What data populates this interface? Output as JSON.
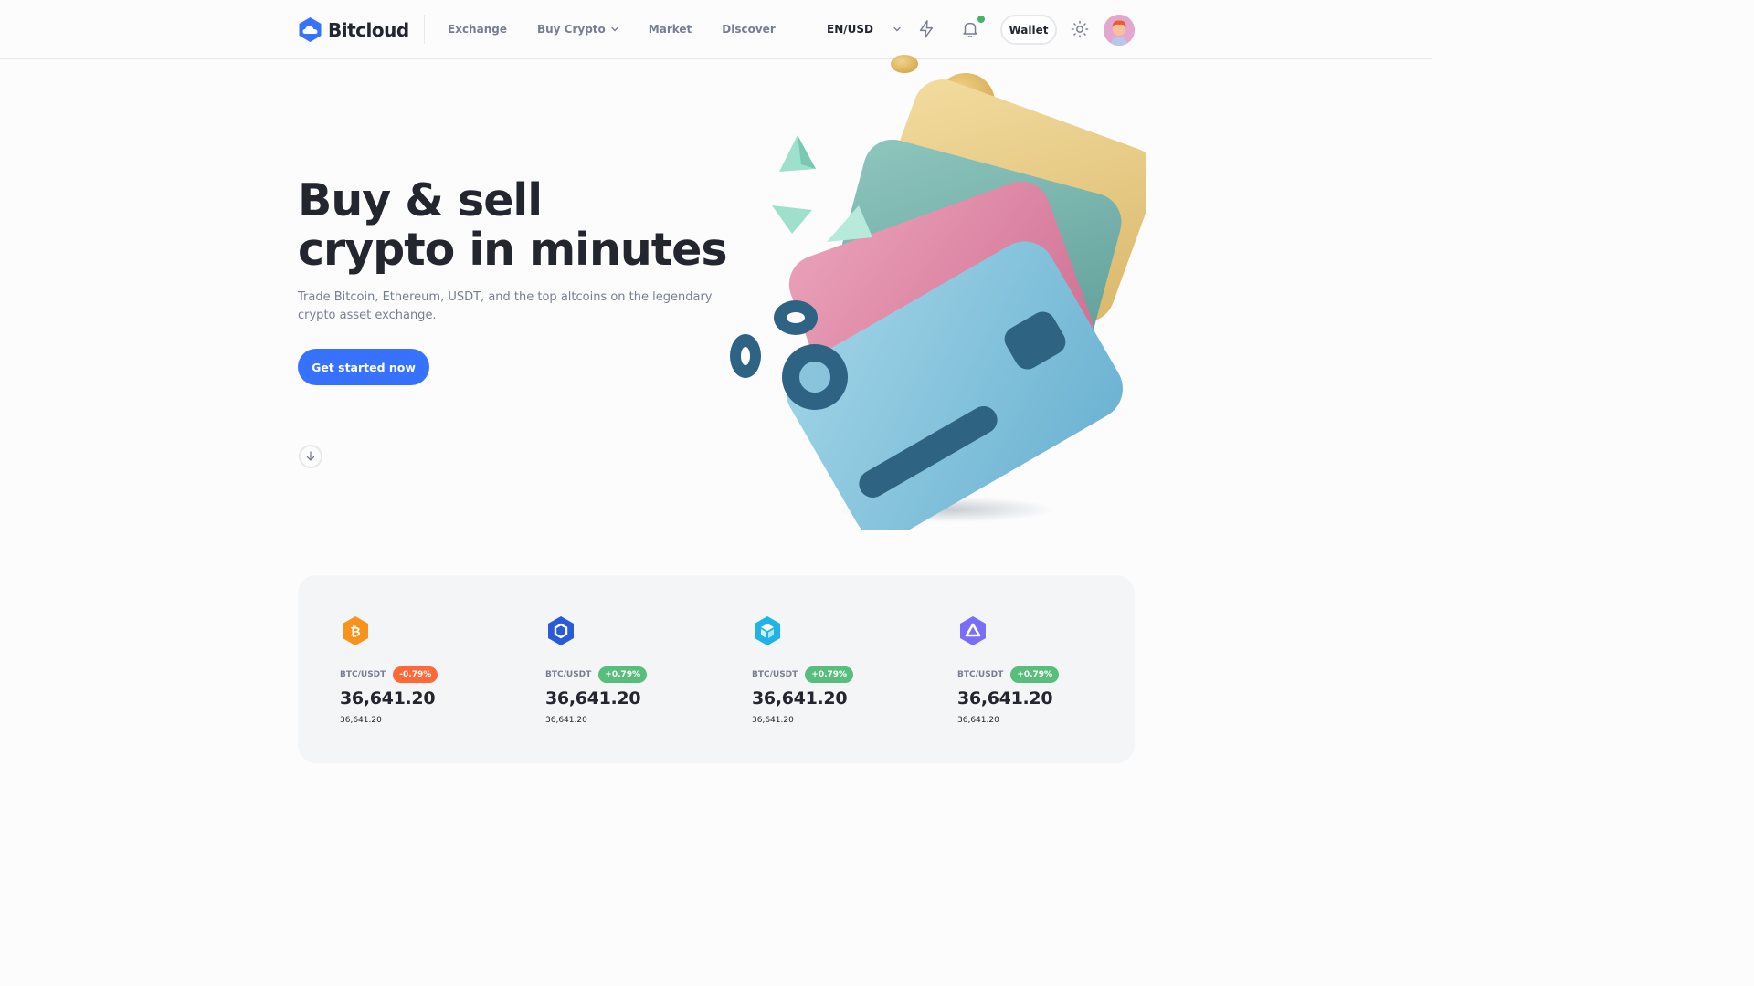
{
  "brand": {
    "name": "Bitcloud",
    "accent": "#3772ff"
  },
  "nav": {
    "items": [
      {
        "label": "Exchange",
        "has_dropdown": false
      },
      {
        "label": "Buy Crypto",
        "has_dropdown": true
      },
      {
        "label": "Market",
        "has_dropdown": false
      },
      {
        "label": "Discover",
        "has_dropdown": false
      }
    ]
  },
  "header": {
    "language": "EN/USD",
    "wallet_label": "Wallet",
    "icons": [
      "lightning-icon",
      "bell-icon",
      "sun-icon"
    ],
    "notification_dot_color": "#45b26b"
  },
  "hero": {
    "title_line1": "Buy & sell",
    "title_line2": "crypto in minutes",
    "subtitle": "Trade Bitcoin, Ethereum, USDT, and the top altcoins on the legendary crypto asset exchange.",
    "cta_label": "Get started now"
  },
  "tickers": [
    {
      "icon": "bitcoin-icon",
      "icon_color": "#f7931a",
      "pair": "BTC/USDT",
      "change": "-0.79%",
      "change_color": "#ff6838",
      "price": "36,641.20",
      "sub_price": "36,641.20"
    },
    {
      "icon": "chainlink-icon",
      "icon_color": "#2a5ada",
      "pair": "BTC/USDT",
      "change": "+0.79%",
      "change_color": "#58bd7d",
      "price": "36,641.20",
      "sub_price": "36,641.20"
    },
    {
      "icon": "cube-icon",
      "icon_color": "#1fb4e4",
      "pair": "BTC/USDT",
      "change": "+0.79%",
      "change_color": "#58bd7d",
      "price": "36,641.20",
      "sub_price": "36,641.20"
    },
    {
      "icon": "triangle-icon",
      "icon_color": "#7b6ef6",
      "pair": "BTC/USDT",
      "change": "+0.79%",
      "change_color": "#58bd7d",
      "price": "36,641.20",
      "sub_price": "36,641.20"
    }
  ]
}
